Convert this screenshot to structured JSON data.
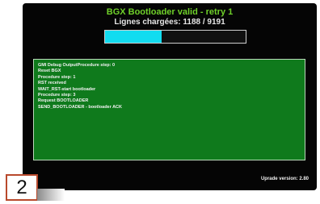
{
  "header": {
    "title": "BGX Bootloader valid - retry 1",
    "subtitle": "Lignes chargées: 1188 / 9191"
  },
  "progress": {
    "loaded": 1188,
    "total": 9191,
    "fill_fraction": 0.4,
    "fill_color": "#12dcf0"
  },
  "log": {
    "background_color": "#0f7a1c",
    "lines": [
      "GMI Debug OutputProcedure step: 0",
      "Reset BGX",
      "Procedure step: 1",
      "RST received",
      "WAIT_RST-start bootloader",
      "Procedure step: 3",
      "Request BOOTLOADER",
      "SEND_BOOTLOADER - bootloader ACK"
    ]
  },
  "footer": {
    "version": "Uprade version: 2.80"
  },
  "step": {
    "number": "2"
  },
  "colors": {
    "title": "#6fd02a",
    "screen_background": "#050505",
    "step_border": "#b8492c"
  }
}
